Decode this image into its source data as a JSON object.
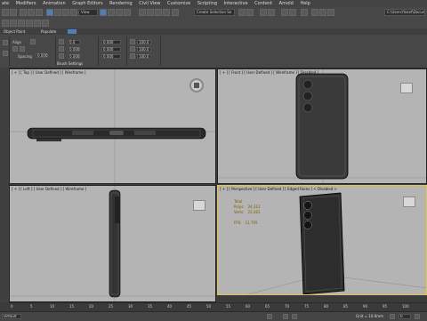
{
  "menu": [
    "ate",
    "Modifiers",
    "Animation",
    "Graph Editors",
    "Rendering",
    "Civil View",
    "Customize",
    "Scripting",
    "Interactive",
    "Content",
    "Arnold",
    "Help"
  ],
  "toolbar": {
    "view_dropdown": "View",
    "selection_set": "Create Selection Se",
    "path": "C:\\Users\\Yosef\\Docum"
  },
  "ribbon": {
    "tabs": [
      "Object Paint",
      "Populate"
    ],
    "align_label": "Align",
    "spacing_label": "Spacing",
    "spacing_value": "0.000",
    "brush_settings": "Brush Settings",
    "fields": {
      "x1": "0.0",
      "x2": "0.000",
      "x3": "100.0",
      "y1": "0.000",
      "y2": "0.000",
      "y3": "100.0",
      "z1": "0.000",
      "z2": "0.000",
      "z3": "100.0"
    }
  },
  "viewports": {
    "top": "[ + ] [ Top ] [ User Defined ] [ Wireframe ]",
    "front": "[ + ] [ Front ] [ User Defined ] [ Wireframe ] [ Disabled ]",
    "left": "[ + ] [ Left ] [ User Defined ] [ Wireframe ]",
    "perspective": "[ + ] [ Perspective ] [ User Defined ] [ Edged Faces ]  < Disabled >"
  },
  "stats": {
    "title": "Total",
    "polys_label": "Polys:",
    "polys_value": "24,312",
    "verts_label": "Verts:",
    "verts_value": "22,361",
    "fps_label": "FPS:",
    "fps_value": "11.705"
  },
  "timeline": {
    "ticks": [
      "0",
      "5",
      "10",
      "15",
      "20",
      "25",
      "30",
      "35",
      "40",
      "45",
      "50",
      "55",
      "60",
      "65",
      "70",
      "75",
      "80",
      "85",
      "90",
      "95",
      "100"
    ]
  },
  "statusbar": {
    "workspace": "Default",
    "grid": "Grid = 10.0mm",
    "frame": "0"
  }
}
